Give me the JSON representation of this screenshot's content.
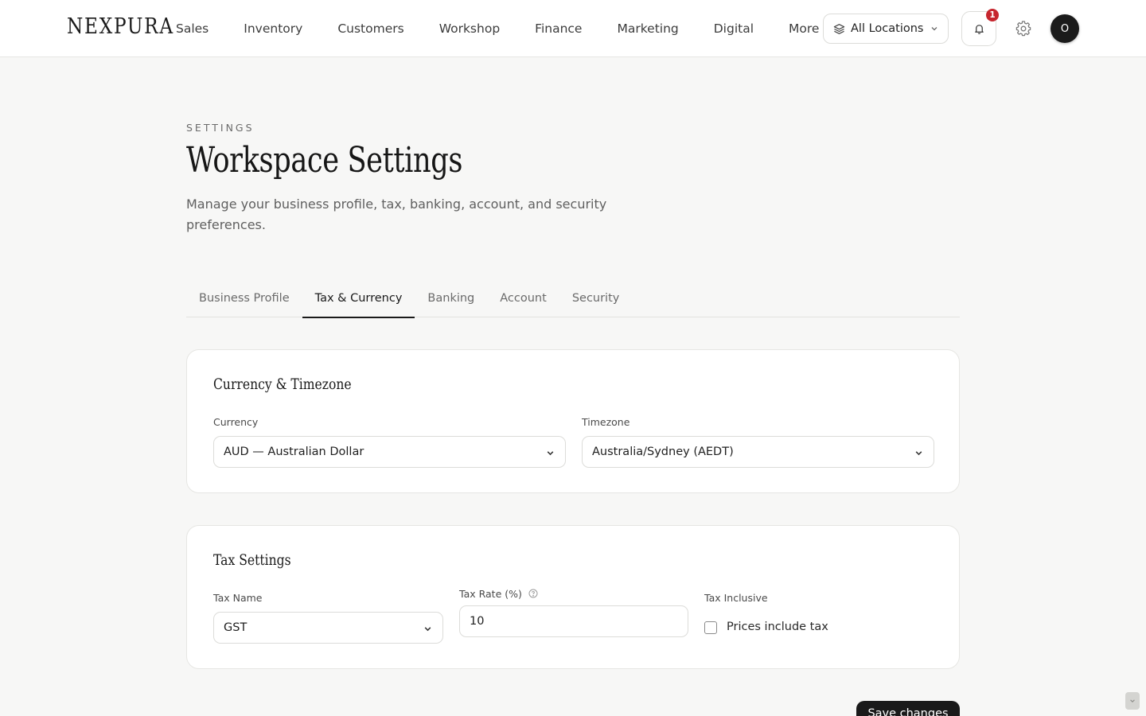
{
  "brand": {
    "logo": "NEXPURA"
  },
  "nav": {
    "items": [
      "Sales",
      "Inventory",
      "Customers",
      "Workshop",
      "Finance",
      "Marketing",
      "Digital",
      "More"
    ]
  },
  "header_controls": {
    "location_label": "All Locations",
    "notification_count": "1",
    "avatar_initial": "O",
    "icons": [
      "layers-icon",
      "chevron-down-icon",
      "bell-icon",
      "gear-icon"
    ]
  },
  "page": {
    "eyebrow": "SETTINGS",
    "title": "Workspace Settings",
    "subtitle": "Manage your business profile, tax, banking, account, and security preferences."
  },
  "tabs": [
    {
      "label": "Business Profile",
      "active": false
    },
    {
      "label": "Tax & Currency",
      "active": true
    },
    {
      "label": "Banking",
      "active": false
    },
    {
      "label": "Account",
      "active": false
    },
    {
      "label": "Security",
      "active": false
    }
  ],
  "currency_card": {
    "title": "Currency & Timezone",
    "currency_label": "Currency",
    "currency_value": "AUD — Australian Dollar",
    "timezone_label": "Timezone",
    "timezone_value": "Australia/Sydney (AEDT)"
  },
  "tax_card": {
    "title": "Tax Settings",
    "tax_name_label": "Tax Name",
    "tax_name_value": "GST",
    "tax_rate_label": "Tax Rate (%)",
    "tax_rate_value": "10",
    "tax_inclusive_label": "Tax Inclusive",
    "tax_inclusive_checkbox_label": "Prices include tax",
    "tax_inclusive_checked": false
  },
  "actions": {
    "save_label": "Save changes"
  },
  "colors": {
    "accent": "#1a1a1a",
    "badge": "#c6262e",
    "background": "#f7f7f6"
  }
}
